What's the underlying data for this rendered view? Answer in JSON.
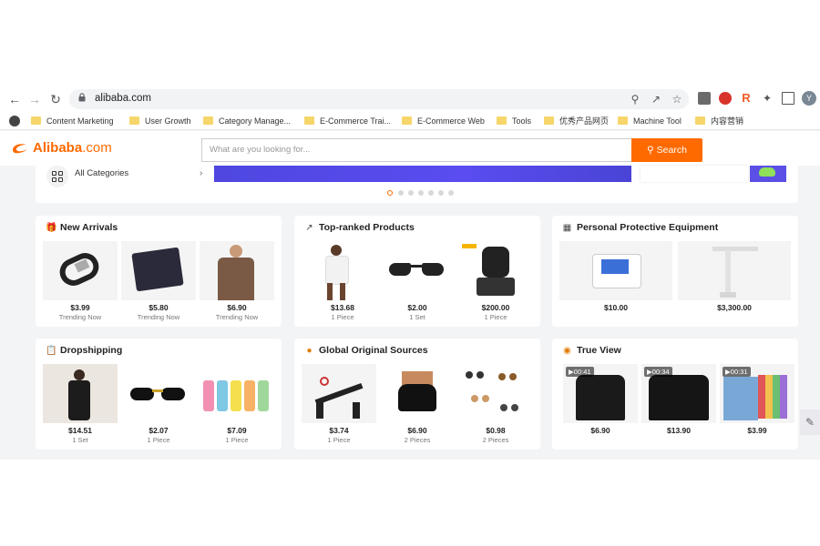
{
  "browser": {
    "url": "alibaba.com",
    "avatar_letter": "Y",
    "bookmarks": [
      "Content Marketing",
      "User Growth",
      "Category Manage...",
      "E-Commerce Trai...",
      "E-Commerce Web",
      "Tools",
      "优秀产品网页",
      "Machine Tool",
      "内容营销"
    ]
  },
  "site": {
    "logo_brand": "Alibaba",
    "logo_domain": ".com",
    "search_placeholder": "What are you looking for...",
    "search_button": "Search",
    "all_categories": "All Categories"
  },
  "carousel": {
    "dot_count": 7,
    "active_index": 0
  },
  "sections": [
    {
      "title": "New Arrivals",
      "icon": "gift-icon",
      "items": [
        {
          "price": "$3.99",
          "sub": "Trending Now"
        },
        {
          "price": "$5.80",
          "sub": "Trending Now"
        },
        {
          "price": "$6.90",
          "sub": "Trending Now"
        }
      ]
    },
    {
      "title": "Top-ranked Products",
      "icon": "trending-chart-icon",
      "items": [
        {
          "price": "$13.68",
          "sub": "1 Piece"
        },
        {
          "price": "$2.00",
          "sub": "1 Set"
        },
        {
          "price": "$200.00",
          "sub": "1 Piece"
        }
      ]
    },
    {
      "title": "Personal Protective Equipment",
      "icon": "building-icon",
      "items": [
        {
          "price": "$10.00",
          "sub": ""
        },
        {
          "price": "$3,300.00",
          "sub": ""
        }
      ]
    },
    {
      "title": "Dropshipping",
      "icon": "clipboard-icon",
      "items": [
        {
          "price": "$14.51",
          "sub": "1 Set"
        },
        {
          "price": "$2.07",
          "sub": "1 Piece"
        },
        {
          "price": "$7.09",
          "sub": "1 Piece"
        }
      ]
    },
    {
      "title": "Global Original Sources",
      "icon": "globe-icon",
      "items": [
        {
          "price": "$3.74",
          "sub": "1 Piece"
        },
        {
          "price": "$6.90",
          "sub": "2 Pieces"
        },
        {
          "price": "$0.98",
          "sub": "2 Pieces"
        }
      ]
    },
    {
      "title": "True View",
      "icon": "eye-icon",
      "items": [
        {
          "price": "$6.90",
          "sub": "",
          "video": "00:41"
        },
        {
          "price": "$13.90",
          "sub": "",
          "video": "00:34"
        },
        {
          "price": "$3.99",
          "sub": "",
          "video": "00:31"
        }
      ]
    }
  ],
  "colors": {
    "brand": "#ff6a00",
    "banner": "#4f47e0",
    "page_bg": "#f3f4f6"
  }
}
